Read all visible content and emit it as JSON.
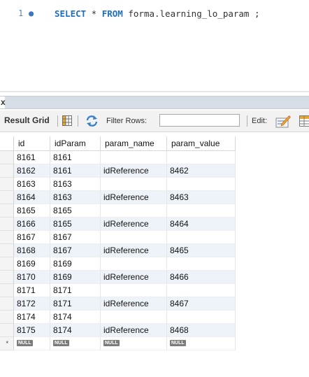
{
  "editor": {
    "line_number": "1",
    "kw_select": "SELECT",
    "star": " * ",
    "kw_from": "FROM",
    "table_ref": " forma.learning_lo_param ;"
  },
  "tab": {
    "close_glyph": "x"
  },
  "toolbar": {
    "result_grid_label": "Result Grid",
    "filter_label": "Filter Rows:",
    "filter_value": "",
    "edit_label": "Edit:"
  },
  "grid": {
    "columns": [
      "id",
      "idParam",
      "param_name",
      "param_value"
    ],
    "rows": [
      [
        "8161",
        "8161",
        "",
        ""
      ],
      [
        "8162",
        "8161",
        "idReference",
        "8462"
      ],
      [
        "8163",
        "8163",
        "",
        ""
      ],
      [
        "8164",
        "8163",
        "idReference",
        "8463"
      ],
      [
        "8165",
        "8165",
        "",
        ""
      ],
      [
        "8166",
        "8165",
        "idReference",
        "8464"
      ],
      [
        "8167",
        "8167",
        "",
        ""
      ],
      [
        "8168",
        "8167",
        "idReference",
        "8465"
      ],
      [
        "8169",
        "8169",
        "",
        ""
      ],
      [
        "8170",
        "8169",
        "idReference",
        "8466"
      ],
      [
        "8171",
        "8171",
        "",
        ""
      ],
      [
        "8172",
        "8171",
        "idReference",
        "8467"
      ],
      [
        "8174",
        "8174",
        "",
        ""
      ],
      [
        "8175",
        "8174",
        "idReference",
        "8468"
      ]
    ],
    "null_label": "NULL",
    "new_row_marker": "*"
  },
  "colors": {
    "keyword": "#1e6fbd",
    "row_shade": "#eef3f9",
    "null_badge": "#7b7b7b"
  }
}
